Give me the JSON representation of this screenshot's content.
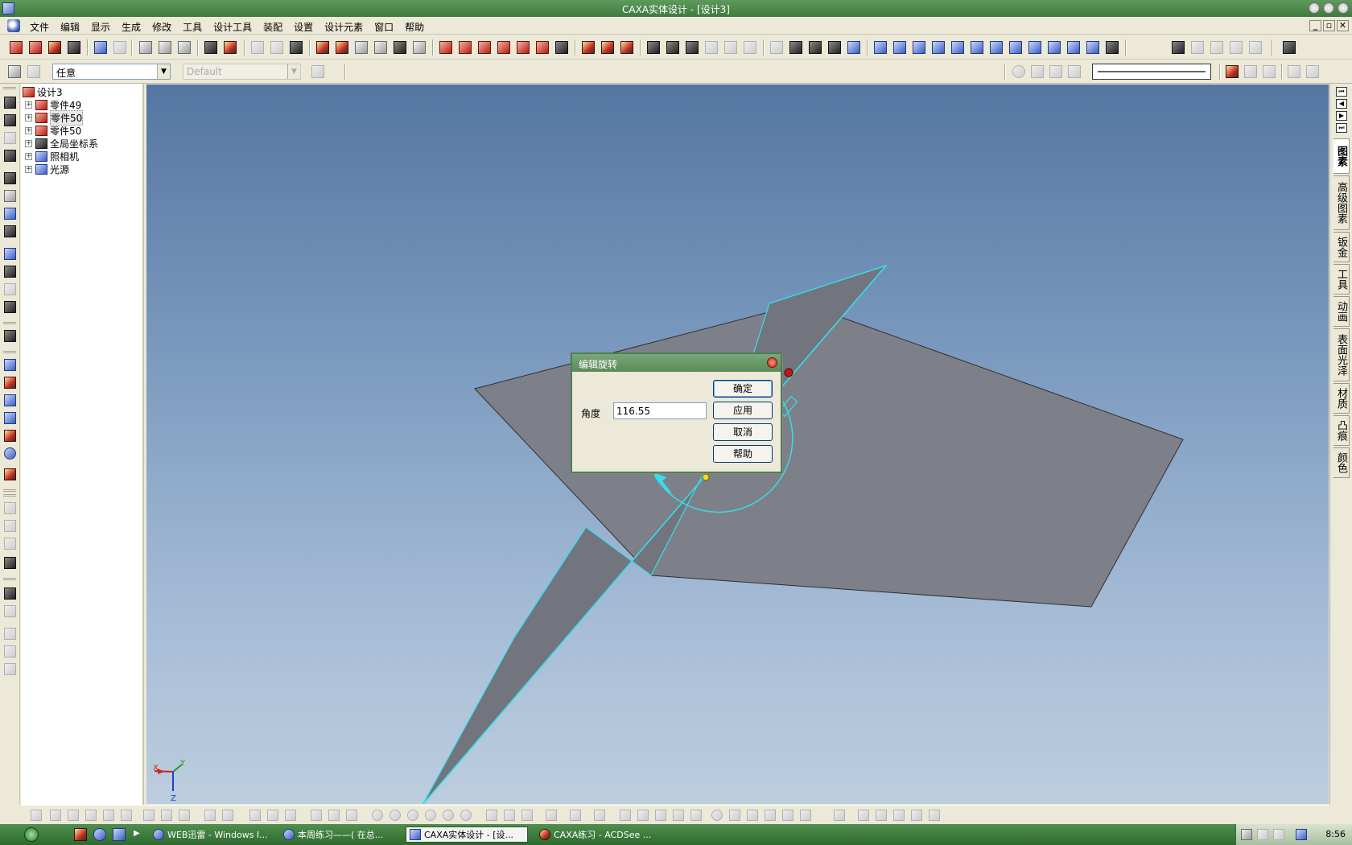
{
  "window": {
    "title": "CAXA实体设计 - [设计3]"
  },
  "menu": {
    "items": [
      "文件",
      "编辑",
      "显示",
      "生成",
      "修改",
      "工具",
      "设计工具",
      "装配",
      "设置",
      "设计元素",
      "窗口",
      "帮助"
    ]
  },
  "toolbar2": {
    "filter_value": "任意",
    "style_value": "Default"
  },
  "tree": {
    "items": [
      {
        "label": "设计3",
        "icon": "design-icon"
      },
      {
        "label": "零件49",
        "icon": "part-icon"
      },
      {
        "label": "零件50",
        "icon": "part-icon"
      },
      {
        "label": "零件50",
        "icon": "part-icon"
      },
      {
        "label": "全局坐标系",
        "icon": "coordinate-system-icon"
      },
      {
        "label": "照相机",
        "icon": "camera-icon"
      },
      {
        "label": "光源",
        "icon": "light-icon"
      }
    ]
  },
  "triad": {
    "x": "X",
    "y": "Y",
    "z": "Z"
  },
  "right_tabs": [
    "图素",
    "高级图素",
    "钣金",
    "工具",
    "动画",
    "表面光泽",
    "材质",
    "凸痕",
    "颜色"
  ],
  "dialog": {
    "title": "编辑旋转",
    "angle_label": "角度",
    "angle_value": "116.55",
    "ok": "确定",
    "apply": "应用",
    "cancel": "取消",
    "help": "帮助"
  },
  "taskbar": {
    "tasks": [
      {
        "label": "WEB迅雷 - Windows I...",
        "active": false
      },
      {
        "label": "本周练习——( 在总...",
        "active": false
      },
      {
        "label": "CAXA实体设计 - [设...",
        "active": true
      },
      {
        "label": "CAXA练习 - ACDSee ...",
        "active": false
      }
    ],
    "clock": "8:56"
  },
  "colors": {
    "titlebar": "#3f7a3f",
    "viewport_top": "#5576a2",
    "highlight": "#33e0ea",
    "surface": "#7e8088"
  }
}
